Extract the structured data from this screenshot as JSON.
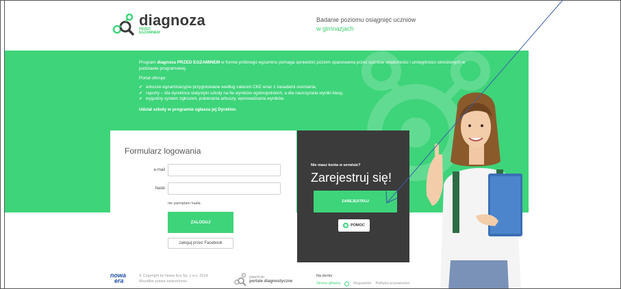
{
  "header": {
    "logo_name": "diagnoza",
    "logo_sub1": "PRZED",
    "logo_sub2": "EGZAMINEM",
    "tagline_line1": "Badanie poziomu osiągnięć uczniów",
    "tagline_line2": "w gimnazjach"
  },
  "intro": {
    "p1_pre": "Program ",
    "p1_bold": "diagnoza PRZED EGZAMINEM",
    "p1_post": " w formie próbnego egzaminu pomaga sprawdzić poziom opanowania przez uczniów wiadomości i umiejętności określonych w podstawie programowej.",
    "offers_label": "Portal oferuje:",
    "items": [
      "arkusze egzaminacyjne przygotowane według zaleceń CKE wraz z zasadami oceniania,",
      "raporty – dla dyrektora statystyki szkoły na tle wyników ogólnopolskich, a dla nauczyciela wyniki klasy,",
      "wygodny system zgłoszeń, pobierania arkuszy, wprowadzania wyników."
    ],
    "closing": "Udział szkoły w programie zgłasza jej Dyrektor."
  },
  "login": {
    "title": "Formularz logowania",
    "email_label": "e-mail",
    "password_label": "hasło",
    "email_value": "",
    "password_value": "",
    "forgot": "nie pamiętam hasła",
    "login_button": "ZALOGUJ",
    "facebook_button": "zaloguj przez Facebook"
  },
  "register": {
    "question": "Nie masz konta w serwisie?",
    "headline": "Zarejestruj się!",
    "register_button": "ZAREJESTRUJ",
    "help_button": "POMOC"
  },
  "footer": {
    "copyright_line1": "© Copyright by Nowa Era Sp. z o.o. 2014",
    "copyright_line2": "Wszelkie prawa zastrzeżone.",
    "portal_line1": "powrót do",
    "portal_line2": "portale diagnostyczne",
    "shortcuts_title": "Na skróty",
    "link_home": "Strona główna",
    "link_rules": "Regulamin",
    "link_privacy": "Polityka prywatności",
    "brand_logo_line1": "nowa",
    "brand_logo_line2": "era"
  },
  "colors": {
    "accent": "#3ed47a",
    "dark_panel": "#3b3b3b",
    "arrow": "#3a5fa8"
  }
}
